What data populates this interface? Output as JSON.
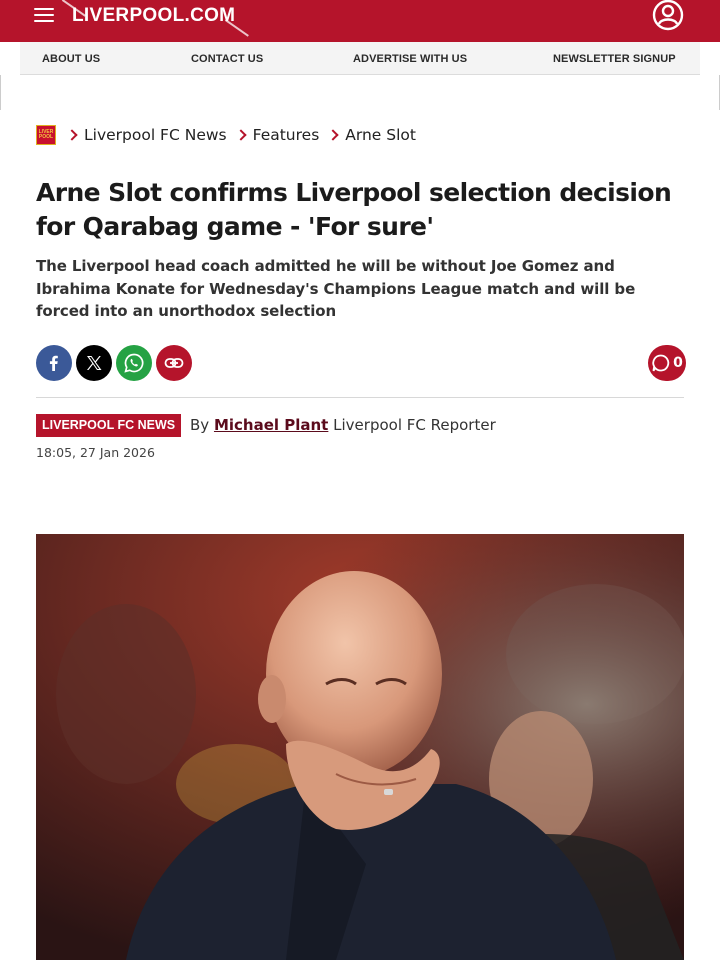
{
  "header": {
    "logo_text": "LIVERPOOL.COM",
    "menu_icon": "hamburger-menu-icon",
    "account_icon": "user-account-icon",
    "brand_color": "#b5142b"
  },
  "subnav": {
    "items": [
      "ABOUT US",
      "CONTACT US",
      "ADVERTISE WITH US",
      "NEWSLETTER SIGNUP"
    ]
  },
  "breadcrumb": {
    "logo_text": "LIVER POOL",
    "items": [
      "Liverpool FC News",
      "Features",
      "Arne Slot"
    ]
  },
  "article": {
    "headline": "Arne Slot confirms Liverpool selection decision for Qarabag game - 'For sure'",
    "standfirst": "The Liverpool head coach admitted he will be without Joe Gomez and Ibrahima Konate for Wednesday's Champions League match and will be forced into an unorthodox selection",
    "section_tag": "LIVERPOOL FC NEWS",
    "byline_prefix": "By",
    "author": "Michael Plant",
    "author_role": "Liverpool FC Reporter",
    "timestamp": "18:05, 27 Jan 2026",
    "comment_count": "0"
  },
  "share": {
    "buttons": [
      "facebook-icon",
      "x-icon",
      "whatsapp-icon",
      "link-icon"
    ],
    "colors": {
      "facebook": "#3b5998",
      "x": "#000000",
      "whatsapp": "#25a244",
      "link": "#b5142b"
    }
  }
}
